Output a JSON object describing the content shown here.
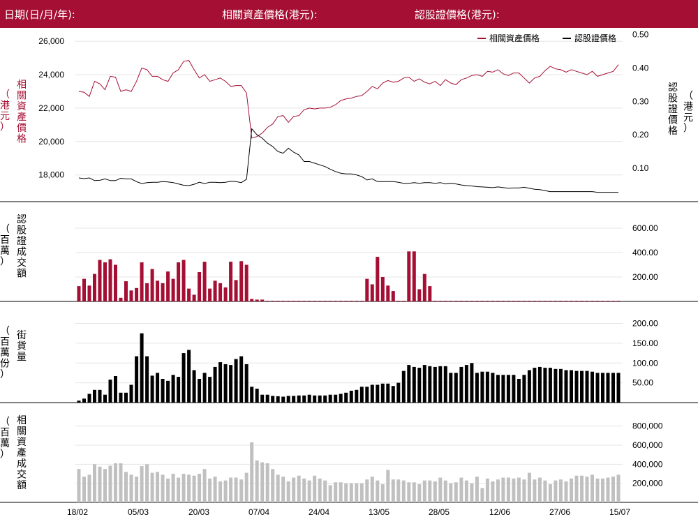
{
  "header": {
    "date_label": "日期(日/月/年):",
    "asset_price_label": "相關資產價格(港元):",
    "warrant_price_label": "認股證價格(港元):"
  },
  "colors": {
    "asset": "#a50f33",
    "warrant": "#000000",
    "turnover_bar": "#a50f33",
    "outstanding_bar": "#000000",
    "asset_turnover_bar": "#c0c0c0"
  },
  "chart_data": [
    {
      "type": "line",
      "legend": {
        "placement": "top-right",
        "entries": [
          "相關資產價格",
          "認股證價格"
        ]
      },
      "left_axis_label": "相關資產價格（港元）",
      "right_axis_label": "認股證價格（港元）",
      "left_ticks": [
        "18,000",
        "20,000",
        "22,000",
        "24,000",
        "26,000"
      ],
      "right_ticks": [
        "0.10",
        "0.20",
        "0.30",
        "0.40",
        "0.50"
      ],
      "ylim_left": [
        16400,
        26800
      ],
      "ylim_right": [
        0,
        0.52
      ],
      "series": [
        {
          "name": "相關資產價格",
          "axis": "left",
          "values": [
            23000,
            22950,
            22700,
            23600,
            23450,
            23100,
            23900,
            23850,
            23000,
            23100,
            23000,
            23600,
            24400,
            24300,
            23900,
            23900,
            23700,
            23600,
            24100,
            24300,
            24800,
            24850,
            24300,
            23800,
            24000,
            23600,
            23700,
            23800,
            23600,
            23300,
            23350,
            23350,
            22900,
            20200,
            20300,
            20500,
            20850,
            21050,
            21500,
            21550,
            21150,
            21500,
            21550,
            21900,
            22000,
            21950,
            22000,
            22000,
            22050,
            22200,
            22450,
            22550,
            22600,
            22700,
            22750,
            23000,
            23300,
            23150,
            23500,
            23650,
            23550,
            23600,
            23800,
            23850,
            23600,
            23750,
            23550,
            23450,
            23600,
            23350,
            23700,
            23500,
            23400,
            23700,
            23800,
            23950,
            24000,
            23900,
            24200,
            24150,
            24300,
            24050,
            23950,
            24100,
            24100,
            23800,
            23500,
            23800,
            23900,
            24250,
            24500,
            24350,
            24300,
            24150,
            24300,
            24200,
            24100,
            24000,
            24200,
            23900,
            24000,
            24100,
            24200,
            24600
          ]
        },
        {
          "name": "認股證價格",
          "axis": "right",
          "values": [
            0.071,
            0.069,
            0.071,
            0.063,
            0.064,
            0.068,
            0.063,
            0.063,
            0.07,
            0.068,
            0.068,
            0.06,
            0.054,
            0.057,
            0.058,
            0.058,
            0.06,
            0.059,
            0.057,
            0.053,
            0.049,
            0.048,
            0.052,
            0.058,
            0.054,
            0.058,
            0.058,
            0.057,
            0.058,
            0.061,
            0.06,
            0.057,
            0.067,
            0.218,
            0.2,
            0.19,
            0.175,
            0.165,
            0.15,
            0.145,
            0.16,
            0.148,
            0.14,
            0.12,
            0.12,
            0.115,
            0.11,
            0.105,
            0.097,
            0.09,
            0.085,
            0.083,
            0.083,
            0.08,
            0.075,
            0.065,
            0.068,
            0.06,
            0.06,
            0.06,
            0.06,
            0.058,
            0.055,
            0.055,
            0.057,
            0.055,
            0.057,
            0.057,
            0.055,
            0.057,
            0.053,
            0.055,
            0.053,
            0.05,
            0.048,
            0.047,
            0.045,
            0.044,
            0.043,
            0.042,
            0.044,
            0.042,
            0.04,
            0.041,
            0.041,
            0.043,
            0.04,
            0.037,
            0.036,
            0.033,
            0.03,
            0.03,
            0.03,
            0.03,
            0.03,
            0.03,
            0.03,
            0.03,
            0.03,
            0.028,
            0.028,
            0.028,
            0.028,
            0.028
          ]
        }
      ]
    },
    {
      "type": "bar",
      "axis_label": "認股證成交額（百萬）",
      "ticks": [
        "200.00",
        "400.00",
        "600.00"
      ],
      "ylim": [
        0,
        720
      ],
      "values": [
        125,
        185,
        130,
        225,
        340,
        320,
        345,
        300,
        30,
        165,
        90,
        110,
        320,
        150,
        265,
        170,
        150,
        245,
        185,
        320,
        340,
        105,
        55,
        240,
        325,
        105,
        170,
        150,
        115,
        325,
        175,
        330,
        300,
        20,
        15,
        15,
        5,
        5,
        5,
        5,
        5,
        5,
        5,
        5,
        5,
        5,
        5,
        5,
        5,
        5,
        5,
        5,
        5,
        5,
        5,
        185,
        140,
        365,
        200,
        130,
        85,
        5,
        5,
        410,
        410,
        100,
        225,
        125,
        5,
        5,
        5,
        5,
        5,
        5,
        5,
        5,
        5,
        5,
        5,
        5,
        5,
        5,
        5,
        5,
        5,
        5,
        5,
        5,
        5,
        5,
        5,
        5,
        5,
        5,
        5,
        5,
        5,
        5,
        5,
        5,
        5,
        5,
        5,
        5
      ]
    },
    {
      "type": "bar",
      "axis_label": "街貨量（百萬份）",
      "ticks": [
        "50.00",
        "100.00",
        "150.00",
        "200.00"
      ],
      "ylim": [
        0,
        215
      ],
      "values": [
        5,
        10,
        22,
        32,
        32,
        20,
        58,
        67,
        25,
        25,
        45,
        117,
        175,
        117,
        68,
        75,
        60,
        55,
        70,
        65,
        125,
        133,
        82,
        60,
        75,
        65,
        90,
        102,
        97,
        95,
        110,
        117,
        97,
        40,
        35,
        20,
        20,
        17,
        16,
        15,
        17,
        17,
        18,
        18,
        20,
        18,
        18,
        18,
        20,
        20,
        22,
        25,
        30,
        32,
        40,
        40,
        45,
        45,
        48,
        48,
        42,
        50,
        80,
        95,
        90,
        88,
        95,
        92,
        90,
        92,
        92,
        75,
        75,
        90,
        95,
        100,
        75,
        78,
        78,
        75,
        70,
        70,
        70,
        70,
        60,
        70,
        82,
        88,
        90,
        88,
        88,
        85,
        85,
        82,
        82,
        80,
        80,
        80,
        78,
        75,
        75,
        75,
        75,
        75
      ]
    },
    {
      "type": "bar",
      "axis_label": "相關資產成交額（百萬）",
      "ticks": [
        "200,000",
        "400,000",
        "600,000",
        "800,000"
      ],
      "ylim": [
        0,
        900000
      ],
      "values": [
        350000,
        270000,
        290000,
        400000,
        375000,
        350000,
        385000,
        410000,
        410000,
        320000,
        290000,
        270000,
        380000,
        400000,
        310000,
        320000,
        290000,
        250000,
        300000,
        260000,
        300000,
        290000,
        280000,
        300000,
        350000,
        250000,
        270000,
        220000,
        230000,
        260000,
        260000,
        240000,
        310000,
        630000,
        440000,
        420000,
        410000,
        350000,
        290000,
        270000,
        220000,
        260000,
        280000,
        250000,
        230000,
        280000,
        250000,
        230000,
        180000,
        210000,
        210000,
        200000,
        200000,
        200000,
        200000,
        240000,
        270000,
        230000,
        190000,
        340000,
        240000,
        240000,
        230000,
        210000,
        210000,
        190000,
        230000,
        230000,
        220000,
        260000,
        230000,
        200000,
        210000,
        260000,
        230000,
        200000,
        270000,
        150000,
        250000,
        220000,
        240000,
        260000,
        260000,
        250000,
        260000,
        240000,
        310000,
        240000,
        260000,
        230000,
        190000,
        230000,
        240000,
        220000,
        250000,
        280000,
        280000,
        270000,
        290000,
        250000,
        250000,
        260000,
        270000,
        290000
      ]
    }
  ],
  "x_ticks": [
    "18/02",
    "05/03",
    "20/03",
    "07/04",
    "24/04",
    "13/05",
    "28/05",
    "12/06",
    "27/06",
    "15/07"
  ]
}
